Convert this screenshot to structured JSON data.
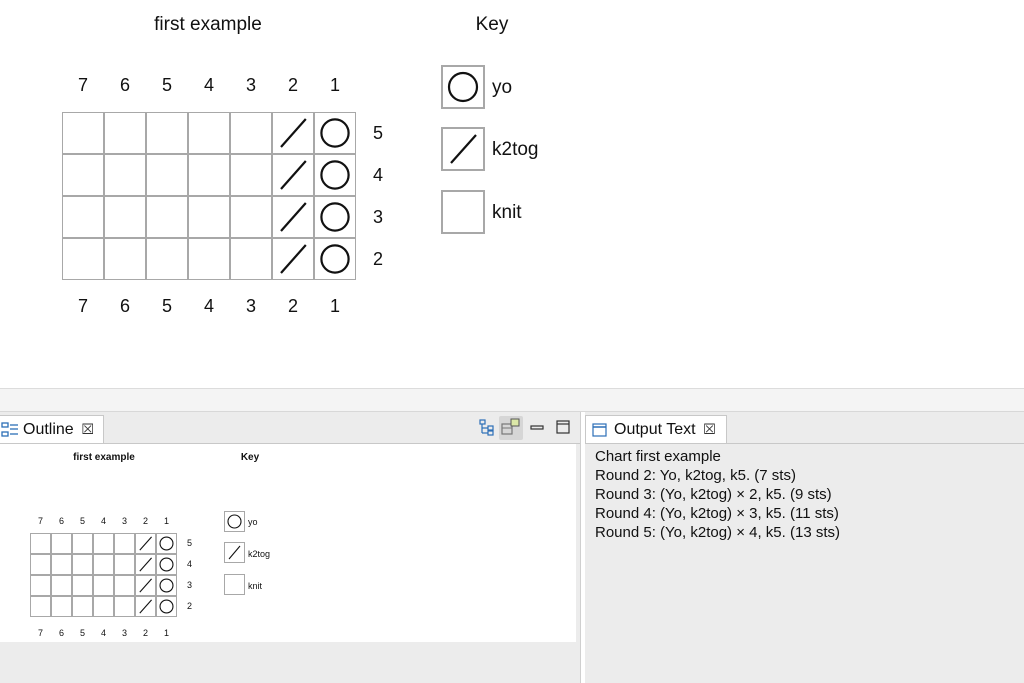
{
  "chart": {
    "title": "first example",
    "columns_top": [
      "7",
      "6",
      "5",
      "4",
      "3",
      "2",
      "1"
    ],
    "columns_bottom": [
      "7",
      "6",
      "5",
      "4",
      "3",
      "2",
      "1"
    ],
    "rows": [
      {
        "label": "5",
        "stitches": [
          "knit",
          "knit",
          "knit",
          "knit",
          "knit",
          "k2tog",
          "yo"
        ]
      },
      {
        "label": "4",
        "stitches": [
          "knit",
          "knit",
          "knit",
          "knit",
          "knit",
          "k2tog",
          "yo"
        ]
      },
      {
        "label": "3",
        "stitches": [
          "knit",
          "knit",
          "knit",
          "knit",
          "knit",
          "k2tog",
          "yo"
        ]
      },
      {
        "label": "2",
        "stitches": [
          "knit",
          "knit",
          "knit",
          "knit",
          "knit",
          "k2tog",
          "yo"
        ]
      }
    ]
  },
  "key": {
    "title": "Key",
    "items": [
      {
        "symbol": "circle-icon",
        "label": "yo"
      },
      {
        "symbol": "slash-icon",
        "label": "k2tog"
      },
      {
        "symbol": "blank",
        "label": "knit"
      }
    ]
  },
  "outline_view": {
    "tab_label": "Outline",
    "icons": [
      "outline-tree-icon",
      "outline-layout-icon",
      "minimize-icon",
      "maximize-icon"
    ]
  },
  "output_view": {
    "tab_label": "Output Text",
    "lines": [
      "Chart first example",
      "Round 2: Yo, k2tog, k5. (7 sts)",
      "Round 3: (Yo, k2tog) × 2, k5. (9 sts)",
      "Round 4: (Yo, k2tog) × 3, k5. (11 sts)",
      "Round 5: (Yo, k2tog) × 4, k5. (13 sts)"
    ]
  },
  "colors": {
    "grid_border": "#a8a8a8",
    "view_background": "#ececec"
  }
}
